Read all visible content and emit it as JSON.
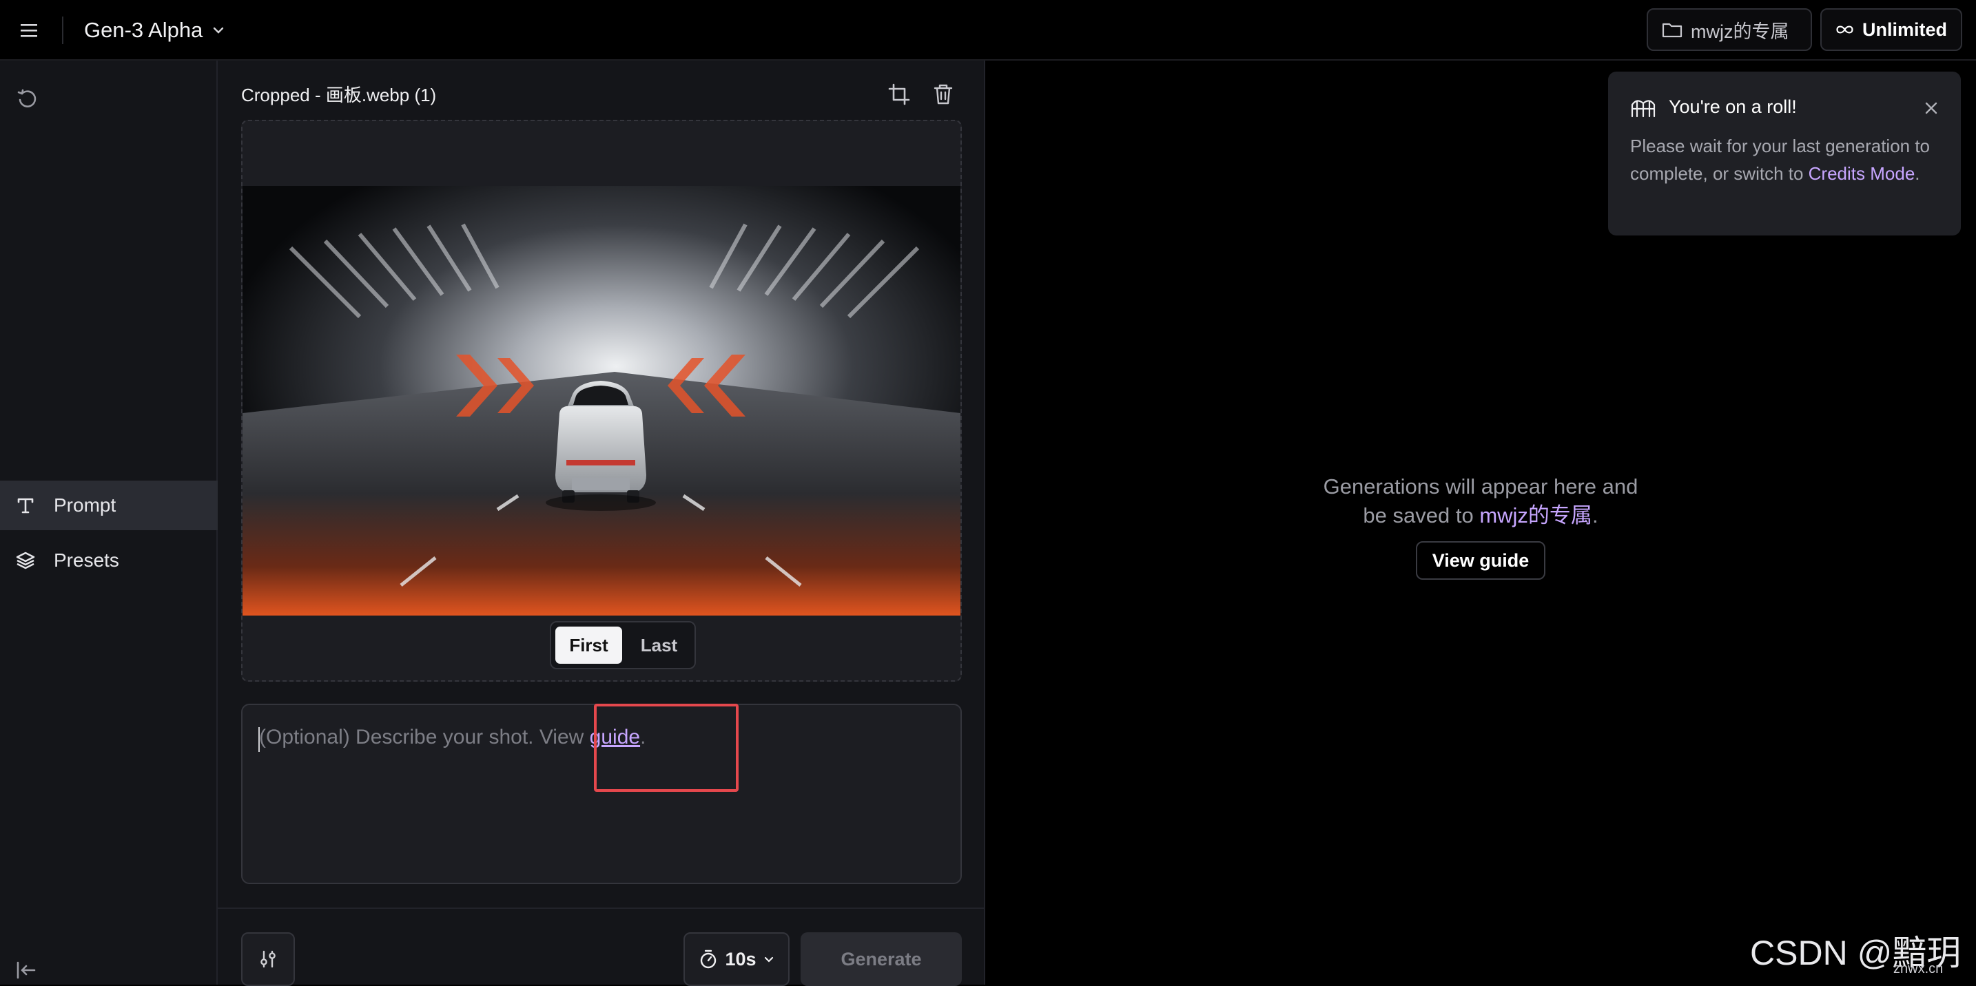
{
  "topbar": {
    "model_name": "Gen-3 Alpha",
    "folder_label": "mwjz的专属",
    "plan_label": "Unlimited"
  },
  "leftnav": {
    "items": [
      {
        "label": "Prompt",
        "icon": "text-icon",
        "active": true
      },
      {
        "label": "Presets",
        "icon": "layers-icon",
        "active": false
      }
    ]
  },
  "editor": {
    "file_title": "Cropped - 画板.webp (1)",
    "frame_first": "First",
    "frame_last": "Last",
    "prompt_placeholder": "(Optional) Describe your shot. View ",
    "guide_link": "guide",
    "prompt_suffix": ".",
    "duration": "10s",
    "generate_label": "Generate"
  },
  "empty_state": {
    "text_line1": "Generations will appear here and",
    "text_line2_prefix": "be saved to ",
    "folder_link": "mwjz的专属",
    "text_line2_suffix": ".",
    "view_guide": "View guide"
  },
  "toast": {
    "title": "You're on a roll!",
    "body": "Please wait for your last generation to complete, or switch to ",
    "link": "Credits Mode",
    "body_suffix": "."
  },
  "watermark": {
    "main": "CSDN @黯玥",
    "sub": "znwx.cn"
  },
  "colors": {
    "accent_link": "#c7a6ff",
    "highlight_border": "#e5484d",
    "panel_bg": "#141519"
  }
}
